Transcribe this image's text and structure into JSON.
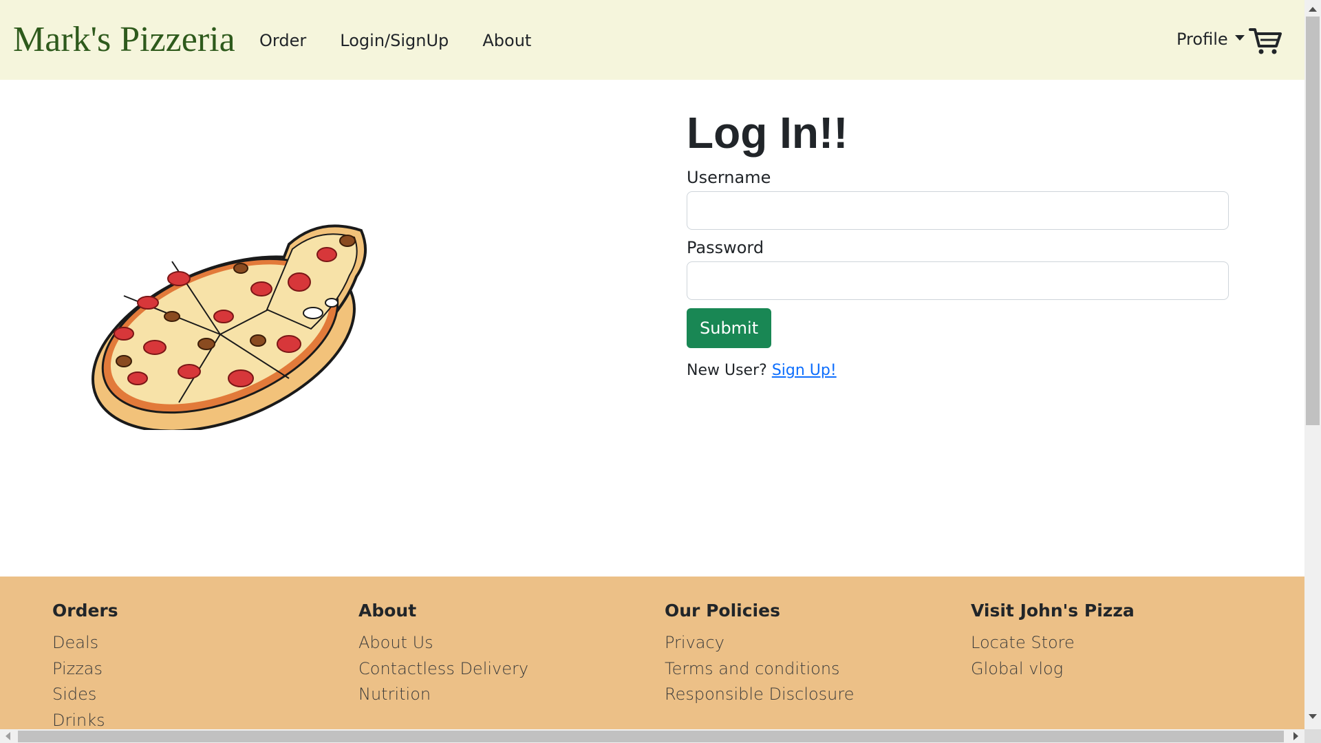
{
  "navbar": {
    "brand": "Mark's Pizzeria",
    "links": [
      "Order",
      "Login/SignUp",
      "About"
    ],
    "profile_label": "Profile",
    "cart_icon": "cart-icon"
  },
  "login": {
    "title": "Log In!!",
    "username_label": "Username",
    "username_value": "",
    "password_label": "Password",
    "password_value": "",
    "submit_label": "Submit",
    "new_user_text": "New User?",
    "signup_link": "Sign Up!"
  },
  "illustration": {
    "icon": "pizza-illustration"
  },
  "footer": {
    "columns": [
      {
        "heading": "Orders",
        "links": [
          "Deals",
          "Pizzas",
          "Sides",
          "Drinks"
        ]
      },
      {
        "heading": "About",
        "links": [
          "About Us",
          "Contactless Delivery",
          "Nutrition"
        ]
      },
      {
        "heading": "Our Policies",
        "links": [
          "Privacy",
          "Terms and conditions",
          "Responsible Disclosure"
        ]
      },
      {
        "heading": "Visit John's Pizza",
        "links": [
          "Locate Store",
          "Global vlog"
        ]
      }
    ]
  },
  "colors": {
    "navbar_bg": "#f5f5dc",
    "brand": "#2e5a1c",
    "submit_bg": "#198754",
    "link": "#0d6efd",
    "footer_bg": "#ecc087"
  }
}
